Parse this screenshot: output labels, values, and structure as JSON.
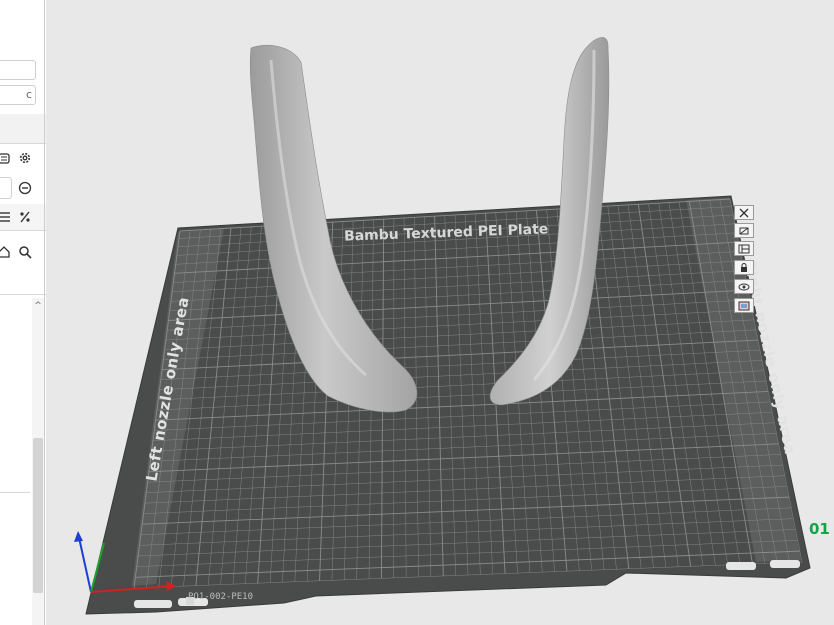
{
  "sidebar": {
    "field_1_value": "",
    "field_2_value": "c",
    "icons": [
      "filament-icon",
      "gear-icon",
      "minus-circle-icon",
      "list-icon",
      "percent-icon",
      "home-icon",
      "search-icon",
      "chevron-up-icon"
    ]
  },
  "plate": {
    "title": "Bambu Textured PEI Plate",
    "left_zone_label": "Left nozzle only area",
    "right_zone_label": "Right nozzle only area",
    "code_text": "PO1-002-PE10",
    "plate_number": "01",
    "plate_color": "#4a4c4c",
    "grid_color": "#8a8c8c",
    "model_color": "#b4b4b4",
    "axis_colors": {
      "x": "#d32020",
      "y": "#1aa32a",
      "z": "#1f3fd0"
    }
  },
  "toolbar": {
    "tools": [
      "close-icon",
      "orient-icon",
      "layout-icon",
      "lock-icon",
      "view-icon",
      "plate-settings-icon"
    ]
  }
}
